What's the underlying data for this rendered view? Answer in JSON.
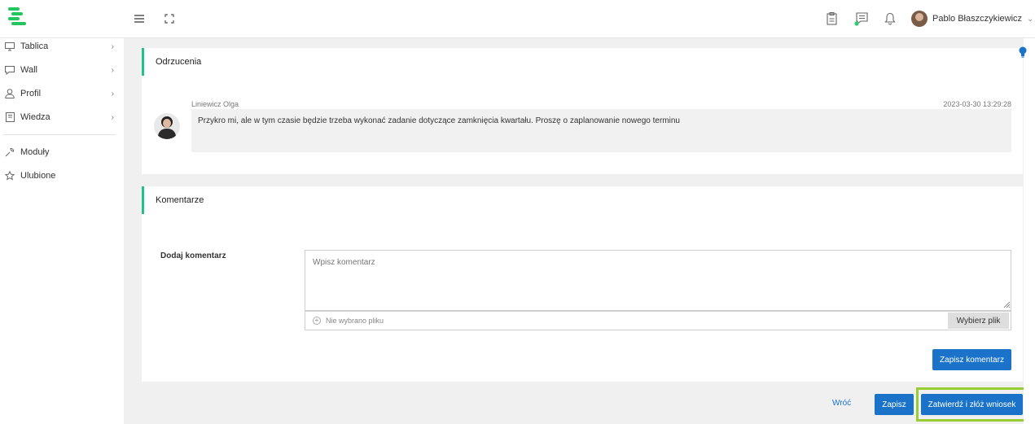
{
  "header": {
    "user_name": "Pablo Błaszczykiewicz",
    "user_chevron": "⌄"
  },
  "sidebar": {
    "items": [
      {
        "label": "Tablica",
        "icon": "monitor-icon",
        "chevron": "›"
      },
      {
        "label": "Wall",
        "icon": "chat-icon",
        "chevron": "›"
      },
      {
        "label": "Profil",
        "icon": "user-icon",
        "chevron": "›"
      },
      {
        "label": "Wiedza",
        "icon": "book-icon",
        "chevron": "›"
      },
      {
        "label": "Moduły",
        "icon": "wrench-icon"
      },
      {
        "label": "Ulubione",
        "icon": "star-icon"
      }
    ]
  },
  "rejections": {
    "title": "Odrzucenia",
    "comment": {
      "author": "Liniewicz Olga",
      "date": "2023-03-30 13:29:28",
      "text": "Przykro mi, ale w tym czasie będzie trzeba wykonać zadanie dotyczące zamknięcia kwartału. Proszę o zaplanowanie nowego terminu"
    }
  },
  "comments": {
    "title": "Komentarze",
    "add_label": "Dodaj komentarz",
    "textarea_placeholder": "Wpisz komentarz",
    "file_status": "Nie wybrano pliku",
    "file_button": "Wybierz plik",
    "save_comment_button": "Zapisz komentarz"
  },
  "footer": {
    "back_label": "Wróć",
    "save_label": "Zapisz",
    "submit_label": "Zatwierdź i złóż wniosek"
  },
  "colors": {
    "accent_green": "#22c08a",
    "primary_blue": "#1a73c9",
    "highlight": "#9acd32"
  }
}
